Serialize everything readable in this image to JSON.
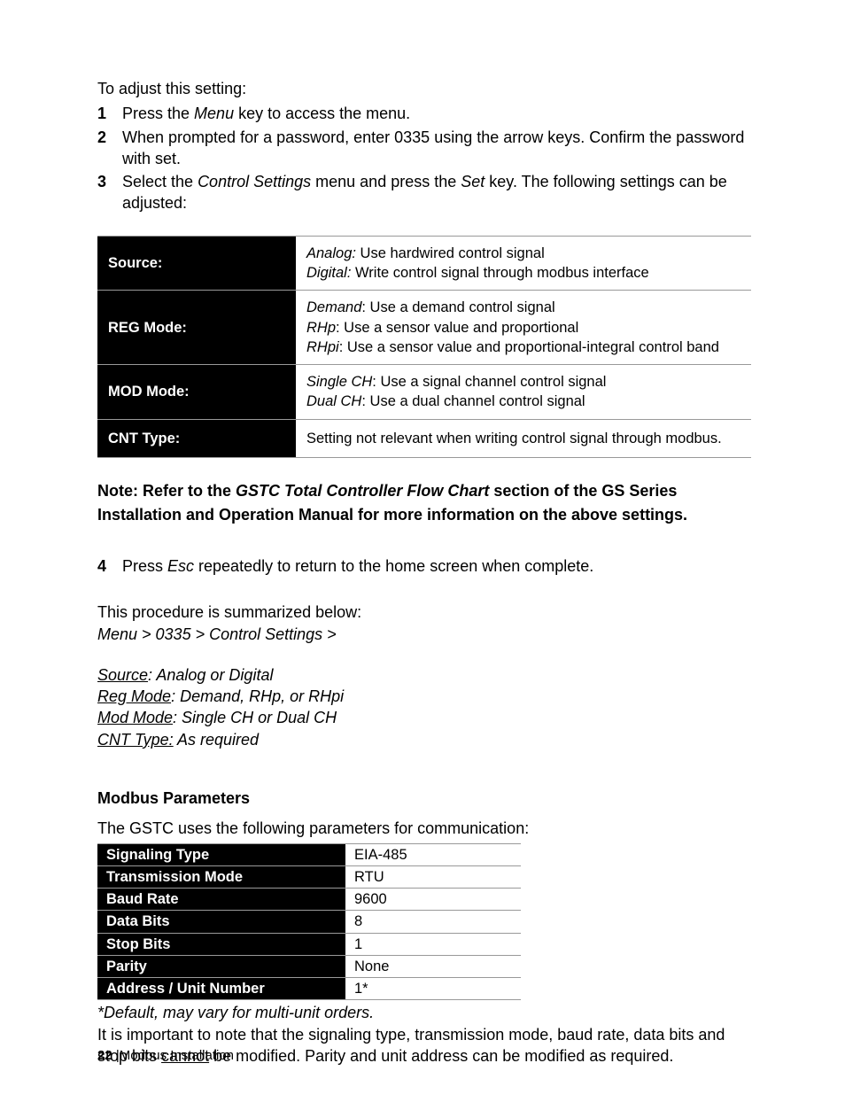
{
  "intro": "To adjust this setting:",
  "steps": [
    {
      "num": "1",
      "parts": [
        "Press the ",
        {
          "i": "Menu"
        },
        " key to access the menu."
      ]
    },
    {
      "num": "2",
      "parts": [
        "When prompted for a password, enter 0335 using the arrow keys.  Confirm the password with set."
      ]
    },
    {
      "num": "3",
      "parts": [
        "Select the ",
        {
          "i": "Control Settings"
        },
        " menu and press the ",
        {
          "i": "Set"
        },
        " key.  The following settings can be adjusted:"
      ]
    }
  ],
  "settings_table": [
    {
      "label": "Source:",
      "lines": [
        [
          {
            "i": "Analog:"
          },
          "  Use hardwired control signal"
        ],
        [
          {
            "i": "Digital:"
          },
          " Write control signal through modbus interface"
        ]
      ]
    },
    {
      "label": "REG Mode:",
      "lines": [
        [
          {
            "i": "Demand"
          },
          ": Use a demand control signal"
        ],
        [
          {
            "i": "RHp"
          },
          ": Use a sensor value and proportional"
        ],
        [
          {
            "i": "RHpi"
          },
          ": Use a sensor value and proportional-integral control band"
        ]
      ]
    },
    {
      "label": "MOD Mode:",
      "lines": [
        [
          {
            "i": "Single CH"
          },
          ": Use a signal channel control signal"
        ],
        [
          {
            "i": "Dual CH"
          },
          ": Use a dual channel control signal"
        ]
      ]
    },
    {
      "label": "CNT Type:",
      "lines": [
        [
          "Setting not relevant when writing control signal through modbus."
        ]
      ]
    }
  ],
  "note_prefix": "Note: Refer to the ",
  "note_flow_title": "GSTC Total Controller Flow Chart",
  "note_suffix": " section of the GS Series Installation and Operation Manual for more information on the above settings.",
  "step4": {
    "num": "4",
    "parts": [
      "Press ",
      {
        "i": "Esc"
      },
      " repeatedly to return to the home screen when complete."
    ]
  },
  "summary_intro": "This procedure is summarized below:",
  "summary_path": "Menu > 0335 > Control Settings >",
  "summary_lines": [
    {
      "u": "Source",
      "rest": ": Analog or Digital"
    },
    {
      "u": "Reg Mode",
      "rest": ": Demand, RHp, or RHpi"
    },
    {
      "u": "Mod Mode",
      "rest": ": Single CH or Dual CH"
    },
    {
      "u": "CNT Type:",
      "rest": " As required"
    }
  ],
  "mbp_heading": "Modbus Parameters",
  "mbp_intro": "The GSTC uses the following parameters for communication:",
  "params_table": [
    {
      "label": "Signaling Type",
      "value": "EIA-485"
    },
    {
      "label": "Transmission Mode",
      "value": "RTU"
    },
    {
      "label": "Baud Rate",
      "value": "9600"
    },
    {
      "label": "Data Bits",
      "value": "8"
    },
    {
      "label": "Stop Bits",
      "value": "1"
    },
    {
      "label": "Parity",
      "value": "None"
    },
    {
      "label": "Address / Unit Number",
      "value": "1*"
    }
  ],
  "foot_note1": "*Default, may vary for multi-unit orders.",
  "foot_note2a": "It is important to note that the signaling type, transmission mode, baud rate, data bits and stop bits ",
  "foot_note2u": "cannot",
  "foot_note2b": " be modified.  Parity and unit address can be modified as required.",
  "footer_page": "22",
  "footer_section": "Modbus Installation"
}
